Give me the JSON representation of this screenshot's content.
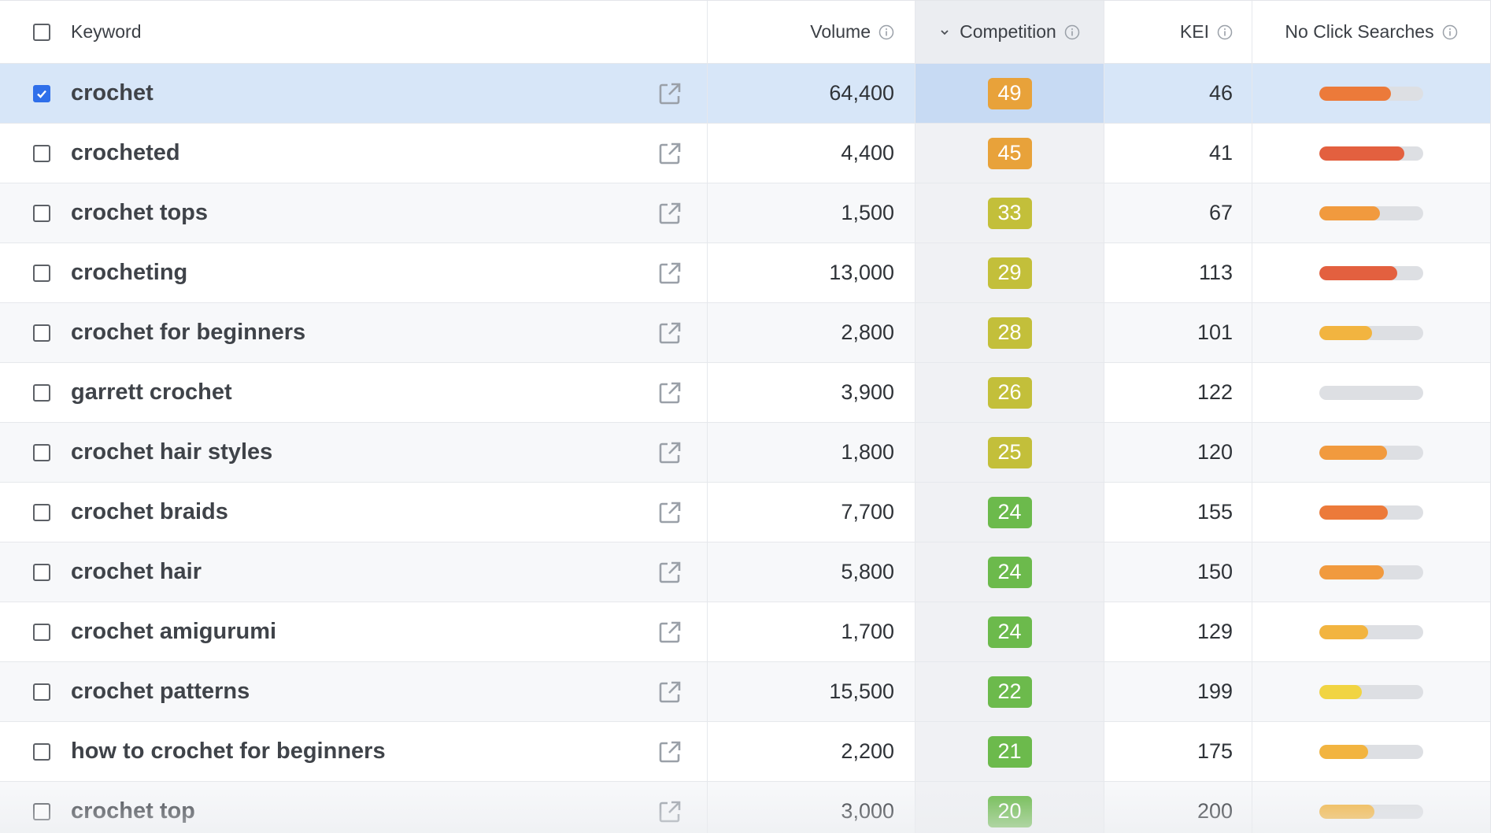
{
  "header": {
    "keyword": "Keyword",
    "volume": "Volume",
    "competition": "Competition",
    "kei": "KEI",
    "no_click": "No Click Searches"
  },
  "rows": [
    {
      "keyword": "crochet",
      "volume": "64,400",
      "competition": "49",
      "comp_color": "#e8a23a",
      "kei": "46",
      "no_click_fraction": 0.69,
      "no_click_color": "#ec7a3a",
      "checked": true
    },
    {
      "keyword": "crocheted",
      "volume": "4,400",
      "competition": "45",
      "comp_color": "#e8a23a",
      "kei": "41",
      "no_click_fraction": 0.82,
      "no_click_color": "#e3603f",
      "checked": false
    },
    {
      "keyword": "crochet tops",
      "volume": "1,500",
      "competition": "33",
      "comp_color": "#c3bf3a",
      "kei": "67",
      "no_click_fraction": 0.58,
      "no_click_color": "#f19a3e",
      "checked": false
    },
    {
      "keyword": "crocheting",
      "volume": "13,000",
      "competition": "29",
      "comp_color": "#c3bf3a",
      "kei": "113",
      "no_click_fraction": 0.75,
      "no_click_color": "#e3603f",
      "checked": false
    },
    {
      "keyword": "crochet for beginners",
      "volume": "2,800",
      "competition": "28",
      "comp_color": "#c3bf3a",
      "kei": "101",
      "no_click_fraction": 0.51,
      "no_click_color": "#f2b440",
      "checked": false
    },
    {
      "keyword": "garrett crochet",
      "volume": "3,900",
      "competition": "26",
      "comp_color": "#c3bf3a",
      "kei": "122",
      "no_click_fraction": 0.0,
      "no_click_color": "#f2b440",
      "checked": false
    },
    {
      "keyword": "crochet hair styles",
      "volume": "1,800",
      "competition": "25",
      "comp_color": "#c3bf3a",
      "kei": "120",
      "no_click_fraction": 0.65,
      "no_click_color": "#f19a3e",
      "checked": false
    },
    {
      "keyword": "crochet braids",
      "volume": "7,700",
      "competition": "24",
      "comp_color": "#6cba4c",
      "kei": "155",
      "no_click_fraction": 0.66,
      "no_click_color": "#ec7a3a",
      "checked": false
    },
    {
      "keyword": "crochet hair",
      "volume": "5,800",
      "competition": "24",
      "comp_color": "#6cba4c",
      "kei": "150",
      "no_click_fraction": 0.62,
      "no_click_color": "#f19a3e",
      "checked": false
    },
    {
      "keyword": "crochet amigurumi",
      "volume": "1,700",
      "competition": "24",
      "comp_color": "#6cba4c",
      "kei": "129",
      "no_click_fraction": 0.47,
      "no_click_color": "#f2b440",
      "checked": false
    },
    {
      "keyword": "crochet patterns",
      "volume": "15,500",
      "competition": "22",
      "comp_color": "#6cba4c",
      "kei": "199",
      "no_click_fraction": 0.41,
      "no_click_color": "#f1d442",
      "checked": false
    },
    {
      "keyword": "how to crochet for beginners",
      "volume": "2,200",
      "competition": "21",
      "comp_color": "#6cba4c",
      "kei": "175",
      "no_click_fraction": 0.47,
      "no_click_color": "#f2b440",
      "checked": false
    },
    {
      "keyword": "crochet top",
      "volume": "3,000",
      "competition": "20",
      "comp_color": "#6cba4c",
      "kei": "200",
      "no_click_fraction": 0.53,
      "no_click_color": "#f2b440",
      "checked": false
    }
  ]
}
